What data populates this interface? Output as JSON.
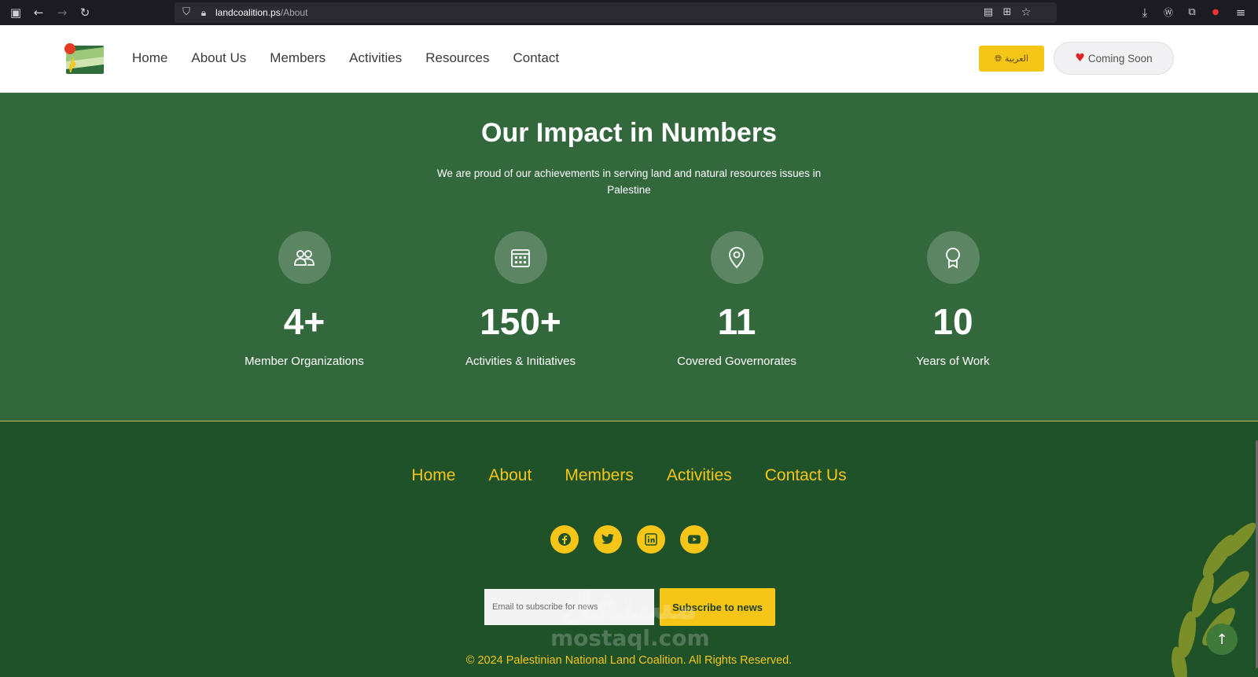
{
  "browser": {
    "url_domain": "landcoalition.ps",
    "url_path": "/About"
  },
  "header": {
    "nav": [
      "Home",
      "About Us",
      "Members",
      "Activities",
      "Resources",
      "Contact"
    ],
    "lang_label": "العربية",
    "coming_soon_label": "Coming Soon"
  },
  "impact": {
    "title": "Our Impact in Numbers",
    "subtitle": "We are proud of our achievements in serving land and natural resources issues in Palestine",
    "stats": [
      {
        "icon": "users-icon",
        "value": "4+",
        "label": "Member Organizations"
      },
      {
        "icon": "calendar-icon",
        "value": "150+",
        "label": "Activities & Initiatives"
      },
      {
        "icon": "map-pin-icon",
        "value": "11",
        "label": "Covered Governorates"
      },
      {
        "icon": "award-icon",
        "value": "10",
        "label": "Years of Work"
      }
    ]
  },
  "footer": {
    "nav": [
      "Home",
      "About",
      "Members",
      "Activities",
      "Contact Us"
    ],
    "socials": [
      "facebook-icon",
      "twitter-icon",
      "linkedin-icon",
      "youtube-icon"
    ],
    "email_placeholder": "Email to subscribe for news",
    "subscribe_label": "Subscribe to news",
    "copyright": "© 2024 Palestinian National Land Coalition. All Rights Reserved.",
    "watermark_ar": "مستقل",
    "watermark_en": "mostaql.com"
  },
  "colors": {
    "impact_bg": "#33683c",
    "footer_bg": "#1f5229",
    "accent": "#f5c518"
  }
}
